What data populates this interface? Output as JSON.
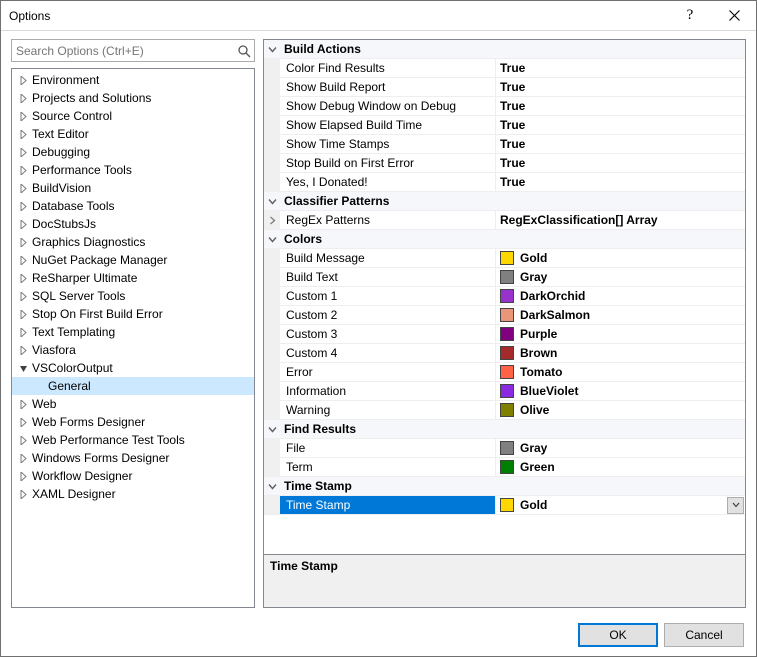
{
  "window": {
    "title": "Options"
  },
  "search": {
    "placeholder": "Search Options (Ctrl+E)"
  },
  "tree": {
    "items": [
      {
        "label": "Environment",
        "expanded": false
      },
      {
        "label": "Projects and Solutions",
        "expanded": false
      },
      {
        "label": "Source Control",
        "expanded": false
      },
      {
        "label": "Text Editor",
        "expanded": false
      },
      {
        "label": "Debugging",
        "expanded": false
      },
      {
        "label": "Performance Tools",
        "expanded": false
      },
      {
        "label": "BuildVision",
        "expanded": false
      },
      {
        "label": "Database Tools",
        "expanded": false
      },
      {
        "label": "DocStubsJs",
        "expanded": false
      },
      {
        "label": "Graphics Diagnostics",
        "expanded": false
      },
      {
        "label": "NuGet Package Manager",
        "expanded": false
      },
      {
        "label": "ReSharper Ultimate",
        "expanded": false
      },
      {
        "label": "SQL Server Tools",
        "expanded": false
      },
      {
        "label": "Stop On First Build Error",
        "expanded": false
      },
      {
        "label": "Text Templating",
        "expanded": false
      },
      {
        "label": "Viasfora",
        "expanded": false
      },
      {
        "label": "VSColorOutput",
        "expanded": true,
        "children": [
          {
            "label": "General",
            "selected": true
          }
        ]
      },
      {
        "label": "Web",
        "expanded": false
      },
      {
        "label": "Web Forms Designer",
        "expanded": false
      },
      {
        "label": "Web Performance Test Tools",
        "expanded": false
      },
      {
        "label": "Windows Forms Designer",
        "expanded": false
      },
      {
        "label": "Workflow Designer",
        "expanded": false
      },
      {
        "label": "XAML Designer",
        "expanded": false
      }
    ]
  },
  "propertyGrid": {
    "categories": [
      {
        "name": "Build Actions",
        "rows": [
          {
            "name": "Color Find Results",
            "value": "True",
            "type": "bool"
          },
          {
            "name": "Show Build Report",
            "value": "True",
            "type": "bool"
          },
          {
            "name": "Show Debug Window on Debug",
            "value": "True",
            "type": "bool"
          },
          {
            "name": "Show Elapsed Build Time",
            "value": "True",
            "type": "bool"
          },
          {
            "name": "Show Time Stamps",
            "value": "True",
            "type": "bool"
          },
          {
            "name": "Stop Build on First Error",
            "value": "True",
            "type": "bool"
          },
          {
            "name": "Yes, I Donated!",
            "value": "True",
            "type": "bool"
          }
        ]
      },
      {
        "name": "Classifier Patterns",
        "rows": [
          {
            "name": "RegEx Patterns",
            "value": "RegExClassification[] Array",
            "type": "array",
            "expandable": true
          }
        ]
      },
      {
        "name": "Colors",
        "rows": [
          {
            "name": "Build Message",
            "value": "Gold",
            "type": "color",
            "swatch": "#ffd700"
          },
          {
            "name": "Build Text",
            "value": "Gray",
            "type": "color",
            "swatch": "#808080"
          },
          {
            "name": "Custom 1",
            "value": "DarkOrchid",
            "type": "color",
            "swatch": "#9932cc"
          },
          {
            "name": "Custom 2",
            "value": "DarkSalmon",
            "type": "color",
            "swatch": "#e9967a"
          },
          {
            "name": "Custom 3",
            "value": "Purple",
            "type": "color",
            "swatch": "#800080"
          },
          {
            "name": "Custom 4",
            "value": "Brown",
            "type": "color",
            "swatch": "#a52a2a"
          },
          {
            "name": "Error",
            "value": "Tomato",
            "type": "color",
            "swatch": "#ff6347"
          },
          {
            "name": "Information",
            "value": "BlueViolet",
            "type": "color",
            "swatch": "#8a2be2"
          },
          {
            "name": "Warning",
            "value": "Olive",
            "type": "color",
            "swatch": "#808000"
          }
        ]
      },
      {
        "name": "Find Results",
        "rows": [
          {
            "name": "File",
            "value": "Gray",
            "type": "color",
            "swatch": "#808080"
          },
          {
            "name": "Term",
            "value": "Green",
            "type": "color",
            "swatch": "#008000"
          }
        ]
      },
      {
        "name": "Time Stamp",
        "rows": [
          {
            "name": "Time Stamp",
            "value": "Gold",
            "type": "color",
            "swatch": "#ffd700",
            "selected": true
          }
        ]
      }
    ]
  },
  "description": {
    "title": "Time Stamp"
  },
  "buttons": {
    "ok": "OK",
    "cancel": "Cancel"
  }
}
